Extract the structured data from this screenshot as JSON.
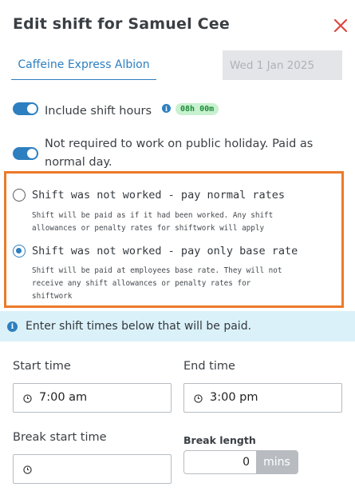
{
  "header": {
    "title": "Edit shift for Samuel Cee"
  },
  "tabs": {
    "location": "Caffeine Express Albion",
    "date": "Wed 1 Jan 2025"
  },
  "toggles": {
    "include_hours": {
      "label": "Include shift hours",
      "badge": "08h 00m",
      "on": true
    },
    "not_required": {
      "label_line1": "Not required to work on public holiday. Paid as",
      "label_line2": "normal day.",
      "on": true
    }
  },
  "options": [
    {
      "label": "Shift was not worked - pay normal rates",
      "desc_line1": "Shift will be paid as if it had been worked. Any shift",
      "desc_line2": "allowances or penalty rates for shiftwork will apply",
      "checked": false
    },
    {
      "label": "Shift was not worked - pay only base rate",
      "desc_line1": "Shift will be paid at employees base rate. They will not",
      "desc_line2": "receive any shift allowances or penalty rates for",
      "desc_line3": "shiftwork",
      "checked": true
    }
  ],
  "banner": {
    "text": "Enter shift times below that will be paid."
  },
  "fields": {
    "start_time": {
      "label": "Start time",
      "value": "7:00 am"
    },
    "end_time": {
      "label": "End time",
      "value": "3:00 pm"
    },
    "break_start": {
      "label": "Break start time",
      "value": ""
    },
    "break_length": {
      "label": "Break length",
      "value": "0",
      "unit": "mins"
    }
  },
  "colors": {
    "accent": "#2d7fc0",
    "highlight_border": "#ec7a2a",
    "close": "#e0473f",
    "badge_bg": "#c7f1cf",
    "banner_bg": "#dbf1f9"
  },
  "icons": [
    "close-icon",
    "info-icon",
    "clock-icon"
  ]
}
